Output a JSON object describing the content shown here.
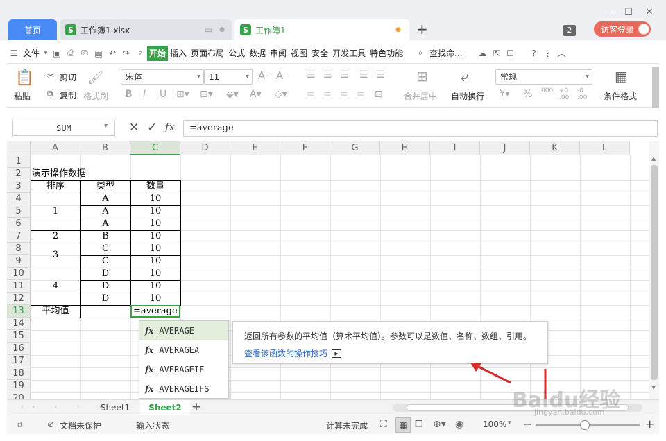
{
  "tabs": {
    "home": "首页",
    "file1": "工作簿1.xlsx",
    "file2": "工作簿1",
    "new_tab": "+",
    "badge": "2",
    "visitor": "访客登录"
  },
  "menu": [
    "文件",
    "开始",
    "插入",
    "页面布局",
    "公式",
    "数据",
    "审阅",
    "视图",
    "安全",
    "开发工具",
    "特色功能",
    "查找命..."
  ],
  "ribbon": {
    "paste": "粘贴",
    "cut": "剪切",
    "copy": "复制",
    "format_painter": "格式刷",
    "font_name": "宋体",
    "font_size": "11",
    "merge_center": "合并居中",
    "wrap_text": "自动换行",
    "number_format": "常规",
    "conditional_format": "条件格式",
    "percent": "%",
    "thousands": "000",
    "inc_dec": "+0 .00",
    "dec_dec": "-0 .00"
  },
  "formula_bar": {
    "name_box": "SUM",
    "fx": "fx",
    "content": "=average"
  },
  "columns": [
    "A",
    "B",
    "C",
    "D",
    "E",
    "F",
    "G",
    "H",
    "I",
    "J",
    "K",
    "L"
  ],
  "rows": [
    "1",
    "2",
    "3",
    "4",
    "5",
    "6",
    "7",
    "8",
    "9",
    "10",
    "11",
    "12",
    "13",
    "14",
    "15",
    "16",
    "17",
    "18",
    "19",
    "20"
  ],
  "sheet": {
    "title": "演示操作数据",
    "headers": [
      "排序",
      "类型",
      "数量"
    ],
    "groups": [
      "1",
      "2",
      "3",
      "4"
    ],
    "types": [
      "A",
      "A",
      "A",
      "B",
      "C",
      "C",
      "D",
      "D",
      "D"
    ],
    "qty": [
      "10",
      "10",
      "10",
      "10",
      "10",
      "10",
      "10",
      "10",
      "10"
    ],
    "avg_label": "平均值",
    "editing": "=average"
  },
  "autocomplete": {
    "items": [
      "AVERAGE",
      "AVERAGEA",
      "AVERAGEIF",
      "AVERAGEIFS"
    ],
    "description": "返回所有参数的平均值（算术平均值）。参数可以是数值、名称、数组、引用。",
    "link": "查看该函数的操作技巧"
  },
  "sheet_tabs": [
    "Sheet1",
    "Sheet2"
  ],
  "status": {
    "protect": "文档未保护",
    "mode": "输入状态",
    "calc": "计算未完成",
    "zoom": "100%"
  },
  "watermark": "Baidu经验",
  "watermark_url": "jingyan.baidu.com"
}
